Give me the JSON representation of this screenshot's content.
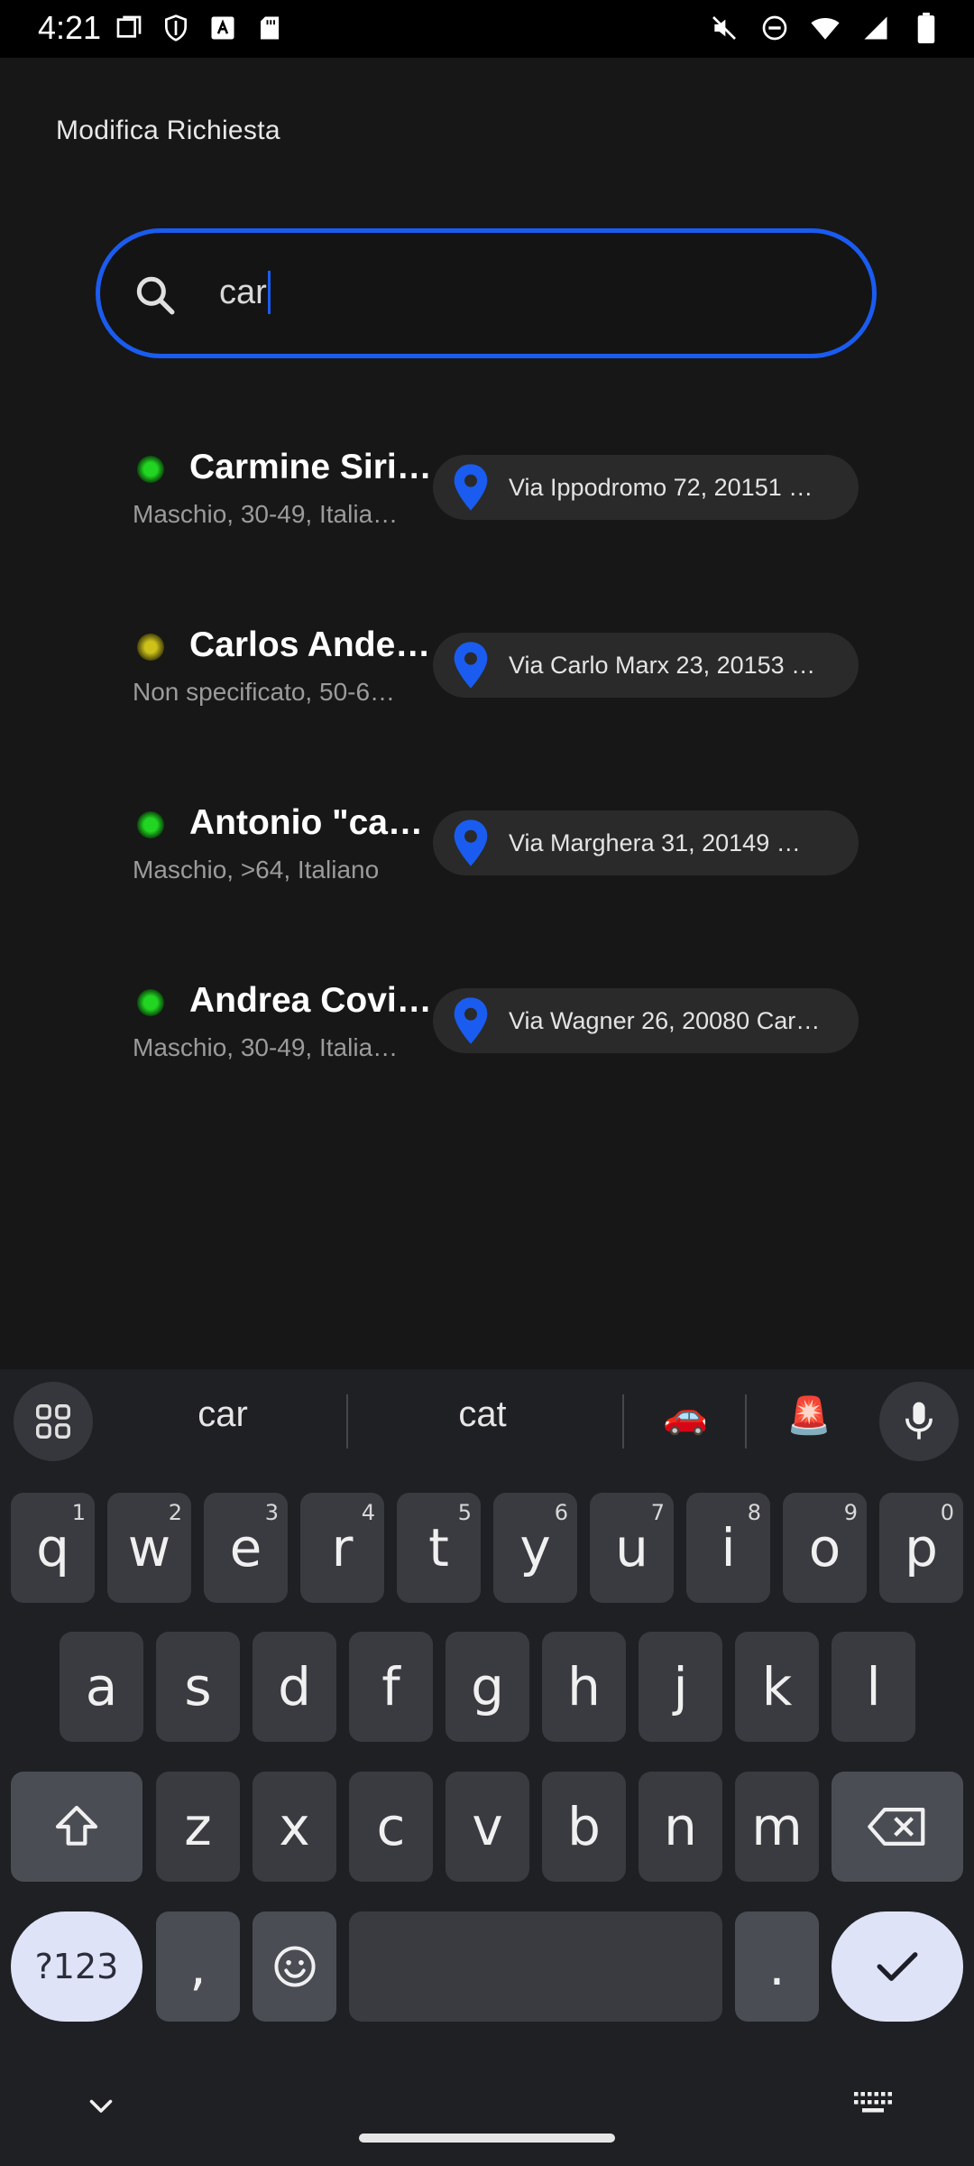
{
  "status_bar": {
    "time": "4:21"
  },
  "page": {
    "title": "Modifica Richiesta"
  },
  "search": {
    "value": "car"
  },
  "results": [
    {
      "status": "green",
      "name": "Carmine Siri…",
      "details": "Maschio, 30-49,  Italia…",
      "address": "Via Ippodromo 72, 20151 …"
    },
    {
      "status": "yellow",
      "name": "Carlos Ande…",
      "details": "Non specificato, 50-6…",
      "address": "Via Carlo Marx 23, 20153 …"
    },
    {
      "status": "green",
      "name": "Antonio \"car…",
      "details": "Maschio, >64,  Italiano",
      "address": "Via Marghera 31, 20149 …"
    },
    {
      "status": "green",
      "name": "Andrea Covi…",
      "details": "Maschio, 30-49,  Italia…",
      "address": "Via Wagner 26, 20080 Car…"
    }
  ],
  "keyboard": {
    "suggestions": [
      "car",
      "cat",
      "🚗",
      "🚨"
    ],
    "row1": [
      {
        "k": "q",
        "h": "1"
      },
      {
        "k": "w",
        "h": "2"
      },
      {
        "k": "e",
        "h": "3"
      },
      {
        "k": "r",
        "h": "4"
      },
      {
        "k": "t",
        "h": "5"
      },
      {
        "k": "y",
        "h": "6"
      },
      {
        "k": "u",
        "h": "7"
      },
      {
        "k": "i",
        "h": "8"
      },
      {
        "k": "o",
        "h": "9"
      },
      {
        "k": "p",
        "h": "0"
      }
    ],
    "row2": [
      "a",
      "s",
      "d",
      "f",
      "g",
      "h",
      "j",
      "k",
      "l"
    ],
    "row3": [
      "z",
      "x",
      "c",
      "v",
      "b",
      "n",
      "m"
    ],
    "symbols_label": "?123",
    "comma": ",",
    "period": "."
  },
  "colors": {
    "accent": "#1a5cf0",
    "online": "#22d522",
    "away": "#cdc21a",
    "background": "#171717"
  }
}
